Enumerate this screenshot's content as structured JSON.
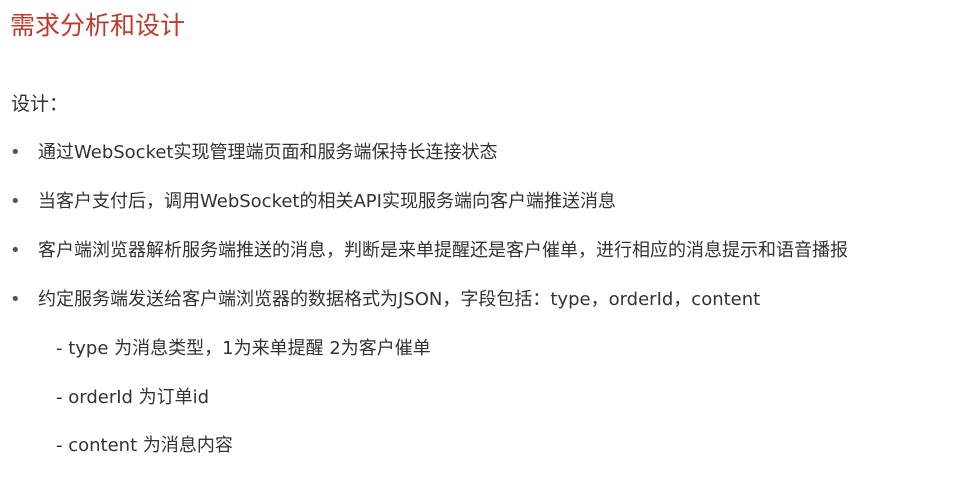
{
  "slide": {
    "title": "需求分析和设计",
    "section_label": "设计：",
    "bullet_marker": "•",
    "bullets": [
      "通过WebSocket实现管理端页面和服务端保持长连接状态",
      "当客户支付后，调用WebSocket的相关API实现服务端向客户端推送消息",
      "客户端浏览器解析服务端推送的消息，判断是来单提醒还是客户催单，进行相应的消息提示和语音播报",
      "约定服务端发送给客户端浏览器的数据格式为JSON，字段包括：type，orderId，content"
    ],
    "sub_items": [
      "- type 为消息类型，1为来单提醒 2为客户催单",
      "- orderId 为订单id",
      "- content 为消息内容"
    ]
  },
  "colors": {
    "title": "#c0392b",
    "text": "#333333",
    "background": "#ffffff"
  }
}
